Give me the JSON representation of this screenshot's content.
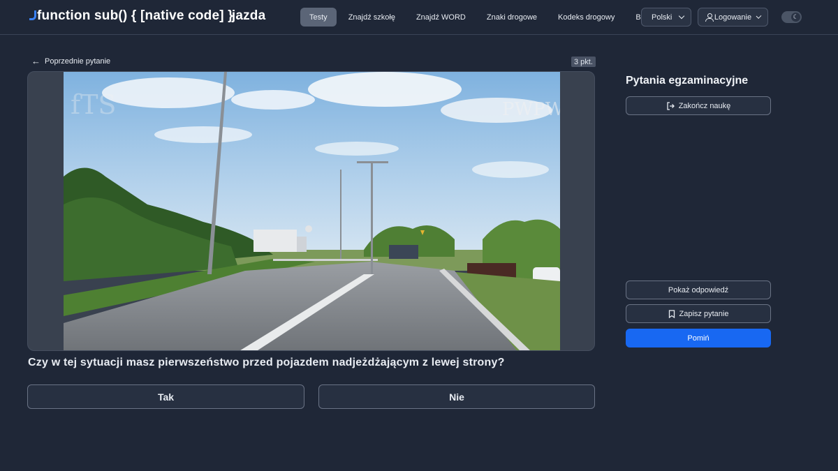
{
  "header": {
    "logo": "jazda",
    "nav": [
      {
        "label": "Testy",
        "active": true
      },
      {
        "label": "Znajdź szkołę",
        "active": false
      },
      {
        "label": "Znajdź WORD",
        "active": false
      },
      {
        "label": "Znaki drogowe",
        "active": false
      },
      {
        "label": "Kodeks drogowy",
        "active": false
      },
      {
        "label": "Blog",
        "active": false
      }
    ],
    "language": "Polski",
    "login": "Logowanie",
    "theme_toggle_icon": "moon-icon"
  },
  "main": {
    "back_label": "Poprzednie pytanie",
    "points": "3 pkt.",
    "media_watermark": "PWPW",
    "question": "Czy w tej sytuacji masz pierwszeństwo przed pojazdem nadjeżdżającym z lewej strony?",
    "answers": {
      "yes": "Tak",
      "no": "Nie"
    }
  },
  "sidebar": {
    "title": "Pytania egzaminacyjne",
    "end_button": "Zakończ naukę",
    "show_answer_button": "Pokaż odpowiedź",
    "save_button": "Zapisz pytanie",
    "skip_button": "Pomiń"
  },
  "colors": {
    "background": "#1f2737",
    "primary": "#1868f2",
    "nav_active": "#5b6577"
  }
}
